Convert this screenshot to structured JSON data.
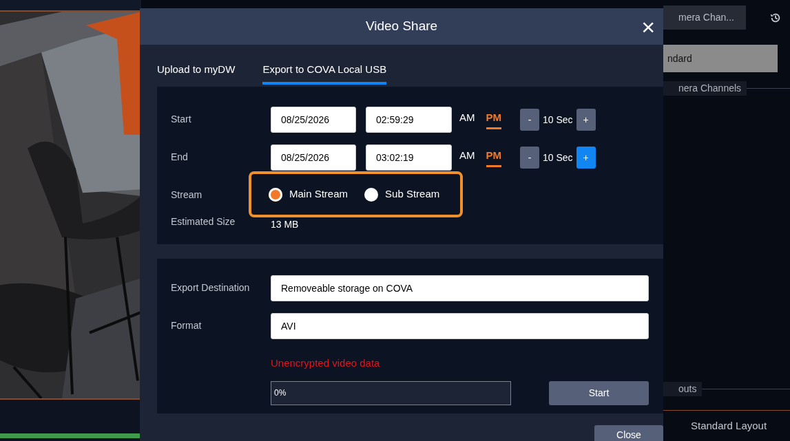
{
  "side_panel": {
    "tab": "mera Chan...",
    "layout_value": "ndard",
    "channels_legend": "nera Channels",
    "layouts_legend": "outs",
    "layout_item": "Standard Layout"
  },
  "dialog": {
    "title": "Video Share",
    "close": "×",
    "tabs": [
      {
        "label": "Upload to myDW",
        "selected": false
      },
      {
        "label": "Export to COVA Local USB",
        "selected": true
      }
    ],
    "time_rows": [
      {
        "label": "Start",
        "date": "08/25/2026",
        "time": "02:59:29",
        "meridiems": [
          {
            "label": "AM",
            "selected": false
          },
          {
            "label": "PM",
            "selected": true
          }
        ],
        "minus": "-",
        "step": "10 Sec",
        "plus": {
          "label": "+",
          "active": false
        }
      },
      {
        "label": "End",
        "date": "08/25/2026",
        "time": "03:02:19",
        "meridiems": [
          {
            "label": "AM",
            "selected": false
          },
          {
            "label": "PM",
            "selected": true
          }
        ],
        "minus": "-",
        "step": "10 Sec",
        "plus": {
          "label": "+",
          "active": true
        }
      }
    ],
    "stream": {
      "label": "Stream",
      "highlighted": true,
      "options": [
        {
          "label": "Main Stream",
          "selected": true
        },
        {
          "label": "Sub Stream",
          "selected": false
        }
      ]
    },
    "estimated_size": {
      "label": "Estimated Size",
      "value": "13 MB"
    },
    "destination": {
      "label": "Export Destination",
      "value": "Removeable storage on COVA"
    },
    "format": {
      "label": "Format",
      "value": "AVI"
    },
    "warning": "Unencrypted video data",
    "progress": {
      "level": 0,
      "reading": "0%"
    },
    "start_button": "Start",
    "close_button": "Close"
  }
}
